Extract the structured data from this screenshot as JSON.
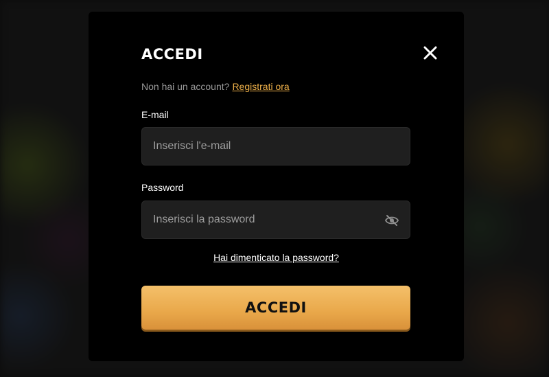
{
  "modal": {
    "title": "ACCEDI",
    "close_icon": "close-icon",
    "signup_prompt": "Non hai un account?",
    "signup_link": "Registrati ora",
    "email": {
      "label": "E-mail",
      "placeholder": "Inserisci l'e-mail",
      "value": ""
    },
    "password": {
      "label": "Password",
      "placeholder": "Inserisci la password",
      "value": "",
      "toggle_icon": "eye-off-icon"
    },
    "forgot_link": "Hai dimenticato la password?",
    "submit_label": "ACCEDI"
  },
  "colors": {
    "accent": "#f0b24a",
    "modal_bg": "#000000",
    "field_bg": "#1f1f1f",
    "button_gradient_top": "#f4c06a",
    "button_gradient_bottom": "#d9913a"
  }
}
